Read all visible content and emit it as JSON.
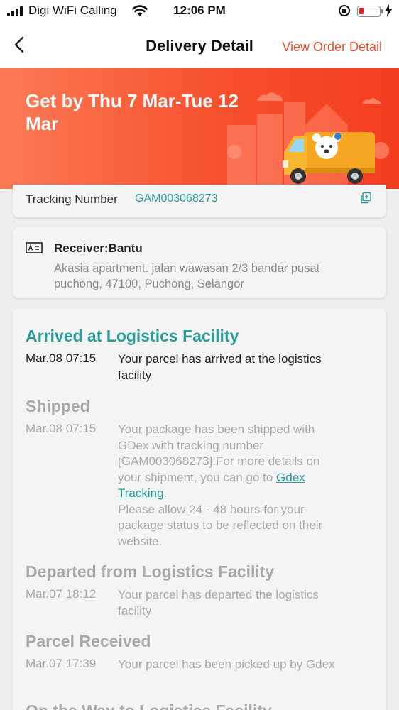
{
  "status_bar": {
    "carrier": "Digi WiFi Calling",
    "time": "12:06 PM"
  },
  "nav": {
    "title": "Delivery Detail",
    "view_order_label": "View Order Detail"
  },
  "banner": {
    "headline": "Get by Thu 7 Mar-Tue 12 Mar"
  },
  "tracking": {
    "label": "Tracking Number",
    "number": "GAM003068273"
  },
  "receiver": {
    "name": "Receiver:Bantu",
    "address": "Akasia apartment. jalan wawasan 2/3 bandar pusat puchong, 47100, Puchong, Selangor"
  },
  "timeline": [
    {
      "title": "Arrived at Logistics Facility",
      "time": "Mar.08 07:15",
      "description": "Your parcel has arrived at the logistics facility"
    },
    {
      "title": "Shipped",
      "time": "Mar.08 07:15",
      "description_before_link": "Your package has been shipped with GDex with tracking number [GAM003068273].For more details on your shipment, you can go to ",
      "link_text": "Gdex Tracking",
      "description_after_link": ".",
      "description_note": " Please allow 24 - 48 hours for your package status to be reflected on their website."
    },
    {
      "title": "Departed from Logistics Facility",
      "time": "Mar.07 18:12",
      "description": "Your parcel has departed the logistics facility"
    },
    {
      "title": "Parcel Received",
      "time": "Mar.07 17:39",
      "description": "Your parcel has been picked up by Gdex"
    },
    {
      "title": "On the Way to Logistics Facility"
    }
  ],
  "colors": {
    "accent": "#ee4d2d",
    "teal": "#2a9d9a",
    "muted": "#a9a9a9"
  }
}
